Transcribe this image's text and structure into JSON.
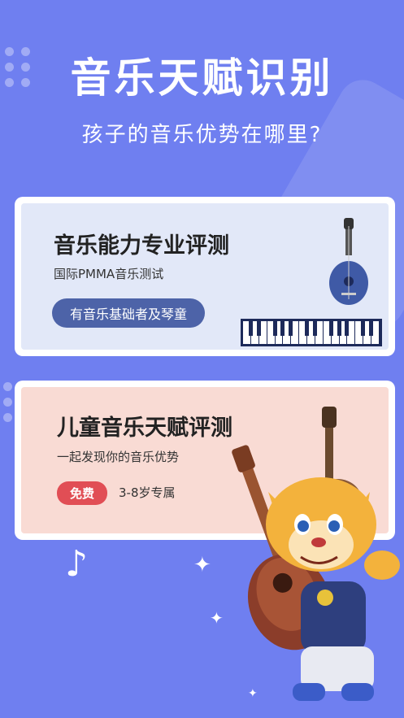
{
  "header": {
    "title": "音乐天赋识别",
    "subtitle": "孩子的音乐优势在哪里?"
  },
  "card_professional": {
    "title": "音乐能力专业评测",
    "subtitle": "国际PMMA音乐测试",
    "button_label": "有音乐基础者及琴童"
  },
  "card_children": {
    "title": "儿童音乐天赋评测",
    "subtitle": "一起发现你的音乐优势",
    "badge_label": "免费",
    "age_range": "3-8岁专属"
  },
  "colors": {
    "background": "#6f7ff0",
    "card1_bg": "#e2e8f8",
    "card2_bg": "#f9dbd4",
    "pill": "#4d63a8",
    "free_badge": "#e14e55"
  },
  "icons": [
    "decorative-dots",
    "lute-icon",
    "piano-keys-icon",
    "guitar-icon",
    "music-note-icon",
    "tiger-mascot"
  ]
}
